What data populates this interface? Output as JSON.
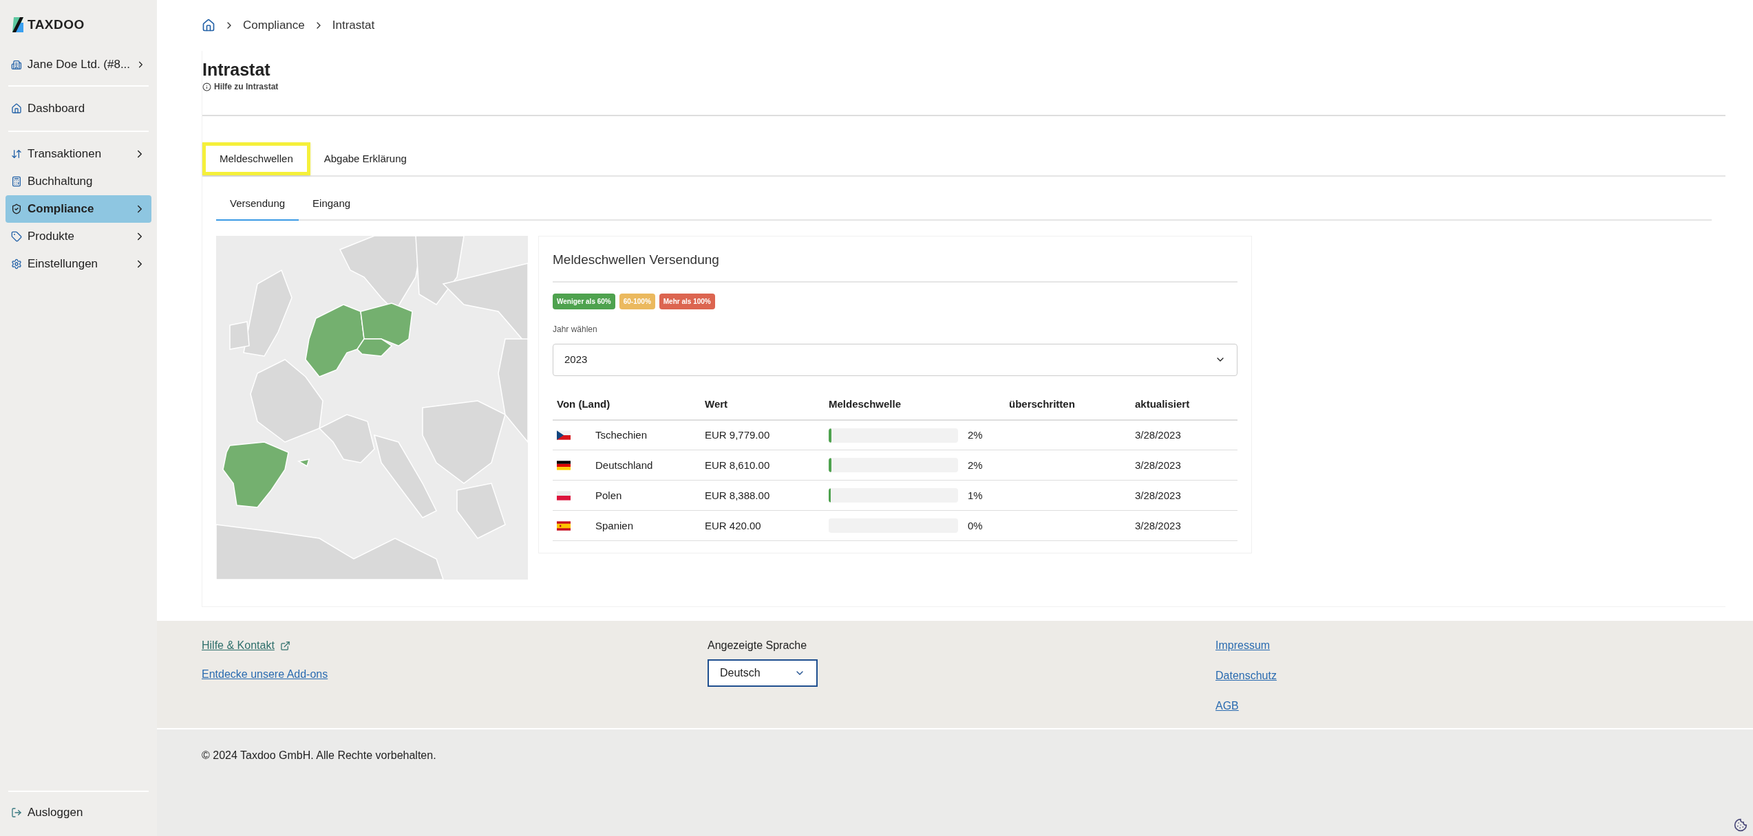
{
  "logo": {
    "text": "TAXDOO"
  },
  "sidebar": {
    "account": {
      "label": "Jane Doe Ltd. (#8..."
    },
    "items": [
      {
        "label": "Dashboard",
        "selected": false,
        "has_children": false
      },
      {
        "label": "Transaktionen",
        "selected": false,
        "has_children": true
      },
      {
        "label": "Buchhaltung",
        "selected": false,
        "has_children": false
      },
      {
        "label": "Compliance",
        "selected": true,
        "has_children": true
      },
      {
        "label": "Produkte",
        "selected": false,
        "has_children": true
      },
      {
        "label": "Einstellungen",
        "selected": false,
        "has_children": true
      }
    ],
    "logout": {
      "label": "Ausloggen"
    }
  },
  "breadcrumb": [
    "Compliance",
    "Intrastat"
  ],
  "page": {
    "title": "Intrastat",
    "help": "Hilfe zu Intrastat"
  },
  "tabs": [
    {
      "label": "Meldeschwellen",
      "selected": true
    },
    {
      "label": "Abgabe Erklärung",
      "selected": false
    }
  ],
  "subtabs": [
    {
      "label": "Versendung",
      "selected": true
    },
    {
      "label": "Eingang",
      "selected": false
    }
  ],
  "card": {
    "title": "Meldeschwellen Versendung",
    "legend": [
      {
        "label": "Weniger als 60%",
        "color": "#4ea24e"
      },
      {
        "label": "60-100%",
        "color": "#ebb95e"
      },
      {
        "label": "Mehr als 100%",
        "color": "#dc6550"
      }
    ],
    "year_label": "Jahr wählen",
    "year": "2023",
    "columns": [
      "Von (Land)",
      "Wert",
      "Meldeschwelle",
      "überschritten",
      "aktualisiert"
    ],
    "rows": [
      {
        "kind": "cz",
        "country": "Tschechien",
        "value": "EUR 9,779.00",
        "level": 0.02,
        "percent": "2%",
        "updated": "3/28/2023"
      },
      {
        "kind": "de",
        "country": "Deutschland",
        "value": "EUR 8,610.00",
        "level": 0.02,
        "percent": "2%",
        "updated": "3/28/2023"
      },
      {
        "kind": "pl",
        "country": "Polen",
        "value": "EUR 8,388.00",
        "level": 0.01,
        "percent": "1%",
        "updated": "3/28/2023"
      },
      {
        "kind": "es",
        "country": "Spanien",
        "value": "EUR 420.00",
        "level": 0,
        "percent": "0%",
        "updated": "3/28/2023"
      }
    ]
  },
  "footer": {
    "left_links": [
      "Hilfe & Kontakt",
      "Entdecke unsere Add-ons"
    ],
    "language_label": "Angezeigte Sprache",
    "language": "Deutsch",
    "right_links": [
      "Impressum",
      "Datenschutz",
      "AGB"
    ],
    "copyright": "© 2024 Taxdoo GmbH. Alle Rechte vorbehalten."
  }
}
